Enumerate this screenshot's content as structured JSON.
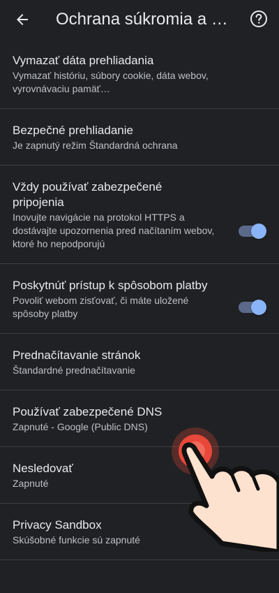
{
  "header": {
    "title": "Ochrana súkromia a zabezpečenie",
    "back_icon": "arrow-back-icon",
    "help_icon": "help-icon"
  },
  "items": [
    {
      "title": "Vymazať dáta prehliadania",
      "subtitle": "Vymazať históriu, súbory cookie, dáta webov, vyrovnávaciu pamäť…"
    },
    {
      "title": "Bezpečné prehliadanie",
      "subtitle": "Je zapnutý režim Štandardná ochrana"
    },
    {
      "title": "Vždy používať zabezpečené pripojenia",
      "subtitle": "Inovujte navigácie na protokol HTTPS a dostávajte upozornenia pred načítaním webov, ktoré ho nepodporujú",
      "toggle": true
    },
    {
      "title": "Poskytnúť prístup k spôsobom platby",
      "subtitle": "Povoliť webom zisťovať, či máte uložené spôsoby platby",
      "toggle": true
    },
    {
      "title": "Prednačítavanie stránok",
      "subtitle": "Štandardné prednačítavanie"
    },
    {
      "title": "Používať zabezpečené DNS",
      "subtitle": "Zapnuté - Google (Public DNS)"
    },
    {
      "title": "Nesledovať",
      "subtitle": "Zapnuté"
    },
    {
      "title": "Privacy Sandbox",
      "subtitle": "Skúšobné funkcie sú zapnuté"
    }
  ],
  "colors": {
    "background": "#202124",
    "text": "#e8eaed",
    "subtext": "#bdc1c6",
    "divider": "#3c4043",
    "accent": "#8ab4f8",
    "tap": "#e8483a"
  }
}
